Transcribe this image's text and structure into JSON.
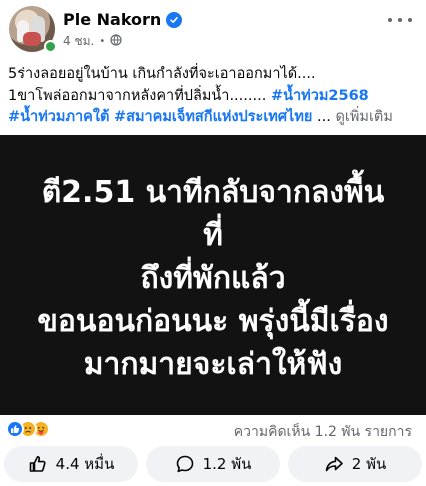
{
  "post": {
    "author": "Ple Nakorn",
    "time": "4 ชม.",
    "text_lines": [
      "5ร่างลอยอยู่ในบ้าน เกินกำลังที่จะเอาออกมาได้....",
      "1ขาโพล่ออกมาจากหลังคาที่ปลิ่มน้ำ........ ",
      "#น้ำท่วม2568",
      "#น้ำท่วมภาคใต้",
      "#สมาคมเจ็ทสกีแห่งประเทศไทย",
      " ... ",
      "ดูเพิ่มเติม"
    ],
    "image_lines": [
      "ตี2.51 นาทีกลับจากลงพื้น",
      "ที่",
      "ถึงที่พักแล้ว",
      "ขอนอนก่อนนะ พรุ่งนี้มีเรื่อง",
      "มากมายจะเล่าให้ฟัง"
    ]
  },
  "stats": {
    "comments_shares": "ความคิดเห็น 1.2 พัน รายการ"
  },
  "actions": {
    "like": "4.4 หมื่น",
    "comment": "1.2 พัน",
    "share": "2 พัน"
  },
  "colors": {
    "accent": "#1877f2",
    "image_bg": "#121212",
    "online": "#31a24c"
  }
}
